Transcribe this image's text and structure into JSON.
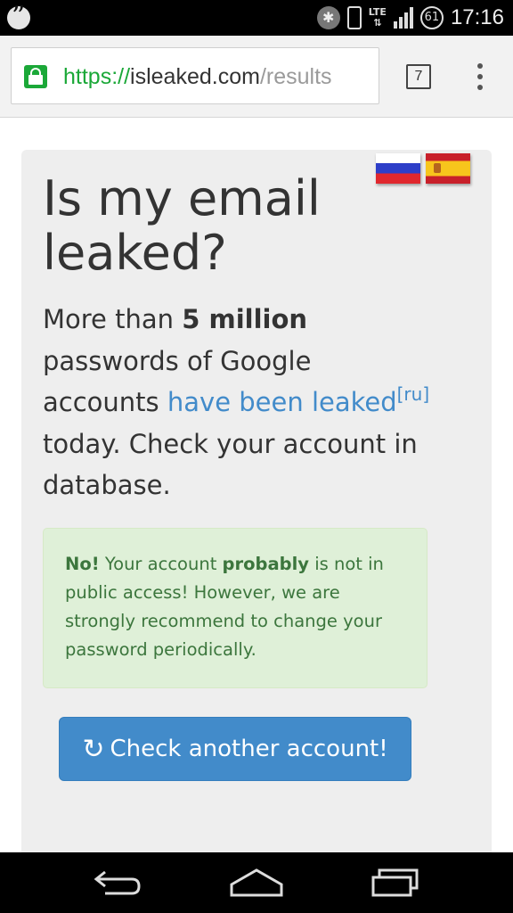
{
  "status_bar": {
    "time": "17:16",
    "battery_level": "61",
    "network_type": "LTE",
    "icons": [
      "hangouts-icon",
      "bluetooth-icon",
      "vibrate-icon",
      "lte-icon",
      "signal-icon",
      "battery-icon"
    ]
  },
  "browser": {
    "url_scheme": "https://",
    "url_domain": "isleaked.com",
    "url_path": "/results",
    "tab_count": "7",
    "colors": {
      "secure": "#1ba838",
      "toolbar": "#f2f2f2"
    }
  },
  "page": {
    "title": "Is my email leaked?",
    "lead": {
      "part1": "More than ",
      "bold": "5 million",
      "part2": " passwords of Google accounts ",
      "link": "have been leaked",
      "sup": "[ru]",
      "part3": " today. Check your account in database."
    },
    "alert": {
      "strong": "No!",
      "text1": " Your account ",
      "bold": "probably",
      "text2": " is not in public access! However, we are strongly recommend to change your password periodically."
    },
    "check_button_label": "Check another account!",
    "flags": [
      "ru",
      "es"
    ],
    "colors": {
      "link": "#428bca",
      "alert_bg": "#dff0d8",
      "alert_text": "#3c763d",
      "button": "#428bca",
      "panel": "#eeeeee"
    }
  },
  "nav_bar": {
    "buttons": [
      "back",
      "home",
      "recents"
    ]
  }
}
